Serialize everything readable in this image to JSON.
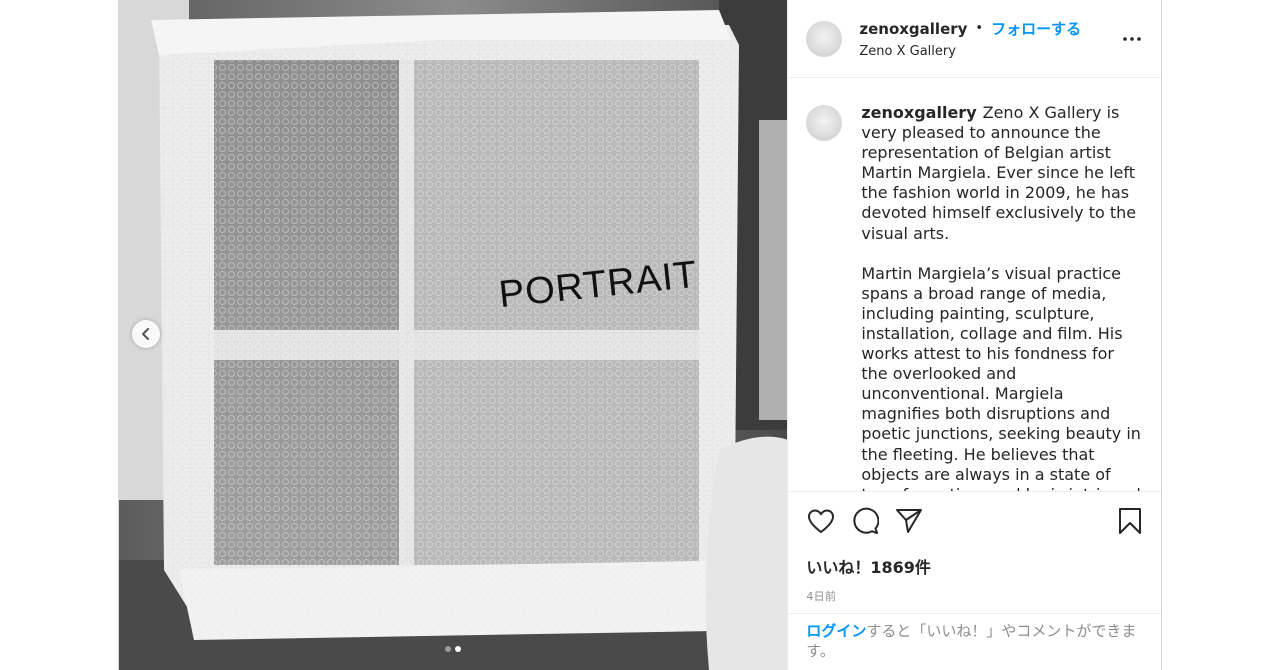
{
  "post": {
    "username": "zenoxgallery",
    "bullet": "•",
    "follow_label": "フォローする",
    "location": "Zeno X Gallery"
  },
  "media": {
    "handwriting": "PORTRAIT",
    "slide_count": 2,
    "active_slide": 2
  },
  "caption": {
    "username": "zenoxgallery",
    "paragraphs": [
      "Zeno X Gallery is very pleased to announce the representation of Belgian artist Martin Margiela. Ever since he left the fashion world in 2009, he has devoted himself exclusively to the visual arts.",
      "Martin Margiela’s visual practice spans a broad range of media, including painting, sculpture, installation, collage and film. His works attest to his fondness for the overlooked and unconventional. Margiela magnifies both disruptions and poetic junctions, seeking beauty in the fleeting. He believes that objects are always in a state of transformation, and he is intrigued by the marks of time. Important sources of inspiration for the"
    ]
  },
  "actions": {
    "likes": "いいね！1869件",
    "time": "4日前"
  },
  "login": {
    "link": "ログイン",
    "rest": "すると「いいね！」やコメントができます。"
  },
  "icons": {
    "prev": "chevron-left-icon",
    "more": "more-horizontal-icon",
    "like": "heart-icon",
    "comment": "comment-icon",
    "share": "paper-plane-icon",
    "save": "bookmark-icon"
  },
  "colors": {
    "link_blue": "#0095f6",
    "text": "#262626",
    "muted": "#8e8e8e"
  }
}
